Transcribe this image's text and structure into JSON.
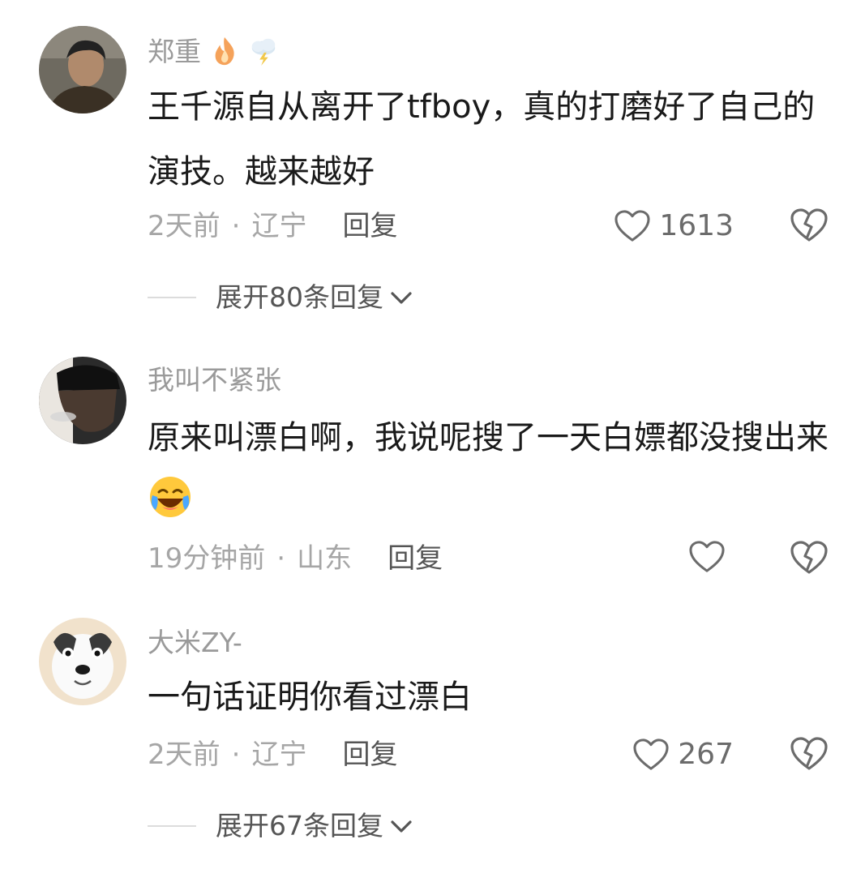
{
  "comments": [
    {
      "username": "郑重",
      "badge_icons": [
        "fire-icon",
        "storm-cloud-icon"
      ],
      "content": "王千源自从离开了tfboy，真的打磨好了自己的演技。越来越好",
      "time": "2天前",
      "location": "辽宁",
      "reply_label": "回复",
      "likes": "1613",
      "expand_label": "展开80条回复"
    },
    {
      "username": "我叫不紧张",
      "content": "原来叫漂白啊，我说呢搜了一天白嫖都没搜出来",
      "content_emoji": "laughing-crying-emoji",
      "time": "19分钟前",
      "location": "山东",
      "reply_label": "回复",
      "likes": ""
    },
    {
      "username": "大米ZY-",
      "content": "一句话证明你看过漂白",
      "time": "2天前",
      "location": "辽宁",
      "reply_label": "回复",
      "likes": "267",
      "expand_label": "展开67条回复"
    }
  ],
  "meta_separator": "·",
  "icons": {
    "like": "heart-outline-icon",
    "dislike": "broken-heart-icon",
    "expand": "chevron-down-icon"
  },
  "colors": {
    "username": "#9a9a9a",
    "content": "#1a1a1a",
    "meta": "#a6a6a6"
  }
}
